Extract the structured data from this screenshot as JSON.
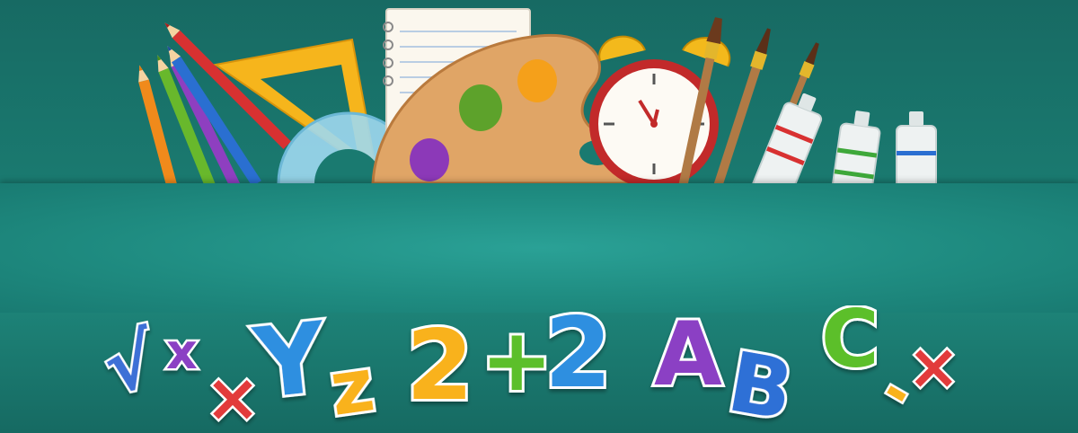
{
  "banner": {
    "theme": "school-supplies",
    "colors": {
      "background": "#1b7c72",
      "band": "#2aa196",
      "purple": "#8b3fc4",
      "blue": "#2f8fe0",
      "yellow": "#f9b21b",
      "green": "#5bbf2b",
      "red": "#e23a3a"
    },
    "supply_icons": [
      "pencil-icon",
      "triangle-ruler-icon",
      "protractor-icon",
      "notepad-icon",
      "paint-palette-icon",
      "alarm-clock-icon",
      "paintbrush-icon",
      "paint-tube-icon"
    ],
    "letters": {
      "sqrt": "√",
      "x_small": "x",
      "times": "×",
      "y": "Y",
      "z": "z",
      "two_a": "2",
      "plus": "+",
      "two_b": "2",
      "a": "A",
      "b": "B",
      "c": "C",
      "minus": "-",
      "times_b": "×"
    }
  }
}
